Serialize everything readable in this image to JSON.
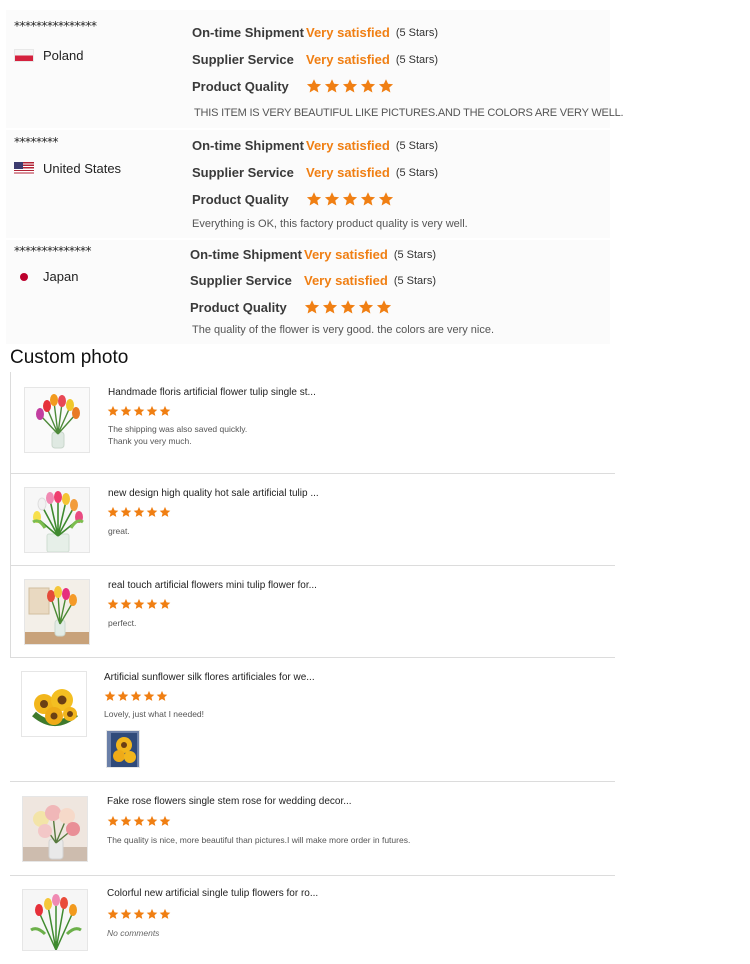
{
  "colors": {
    "accent": "#f07f13",
    "star": "#f07f13"
  },
  "reviews": [
    {
      "masked_name": "***************",
      "country": "Poland",
      "flag_icon": "poland-flag-icon",
      "shipment_label": "On-time Shipment",
      "shipment_value": "Very satisfied",
      "shipment_note": "(5 Stars)",
      "service_label": "Supplier Service",
      "service_value": "Very satisfied",
      "service_note": "(5 Stars)",
      "quality_label": "Product Quality",
      "quality_stars": 5,
      "comment": "THIS ITEM IS VERY BEAUTIFUL LIKE PICTURES.AND THE COLORS ARE VERY WELL."
    },
    {
      "masked_name": "********",
      "country": "United States",
      "flag_icon": "usa-flag-icon",
      "shipment_label": "On-time Shipment",
      "shipment_value": "Very satisfied",
      "shipment_note": "(5 Stars)",
      "service_label": "Supplier Service",
      "service_value": "Very satisfied",
      "service_note": "(5 Stars)",
      "quality_label": "Product Quality",
      "quality_stars": 5,
      "comment": "Everything is OK, this factory product quality is very well."
    },
    {
      "masked_name": "**************",
      "country": "Japan",
      "flag_icon": "japan-flag-icon",
      "shipment_label": "On-time Shipment",
      "shipment_value": "Very satisfied",
      "shipment_note": "(5 Stars)",
      "service_label": "Supplier Service",
      "service_value": "Very satisfied",
      "service_note": "(5 Stars)",
      "quality_label": "Product Quality",
      "quality_stars": 5,
      "comment": "The quality of the flower is very good. the colors are very nice."
    }
  ],
  "custom_photo": {
    "title": "Custom photo",
    "items": [
      {
        "title": "Handmade floris artificial flower tulip single st...",
        "stars": 5,
        "comment": "The shipping was also saved quickly.\nThank you very much."
      },
      {
        "title": "new design high quality hot sale artificial tulip ...",
        "stars": 5,
        "comment": "great."
      },
      {
        "title": "real touch artificial flowers mini tulip flower for...",
        "stars": 5,
        "comment": "perfect."
      },
      {
        "title": "Artificial sunflower silk flores artificiales for we...",
        "stars": 5,
        "comment": "Lovely, just what I needed!"
      },
      {
        "title": "Fake rose flowers single stem rose for wedding decor...",
        "stars": 5,
        "comment": "The quality is nice, more beautiful than pictures.I will make more  order in futures."
      },
      {
        "title": "Colorful new artificial single tulip flowers for ro...",
        "stars": 5,
        "comment": "No comments"
      }
    ]
  }
}
